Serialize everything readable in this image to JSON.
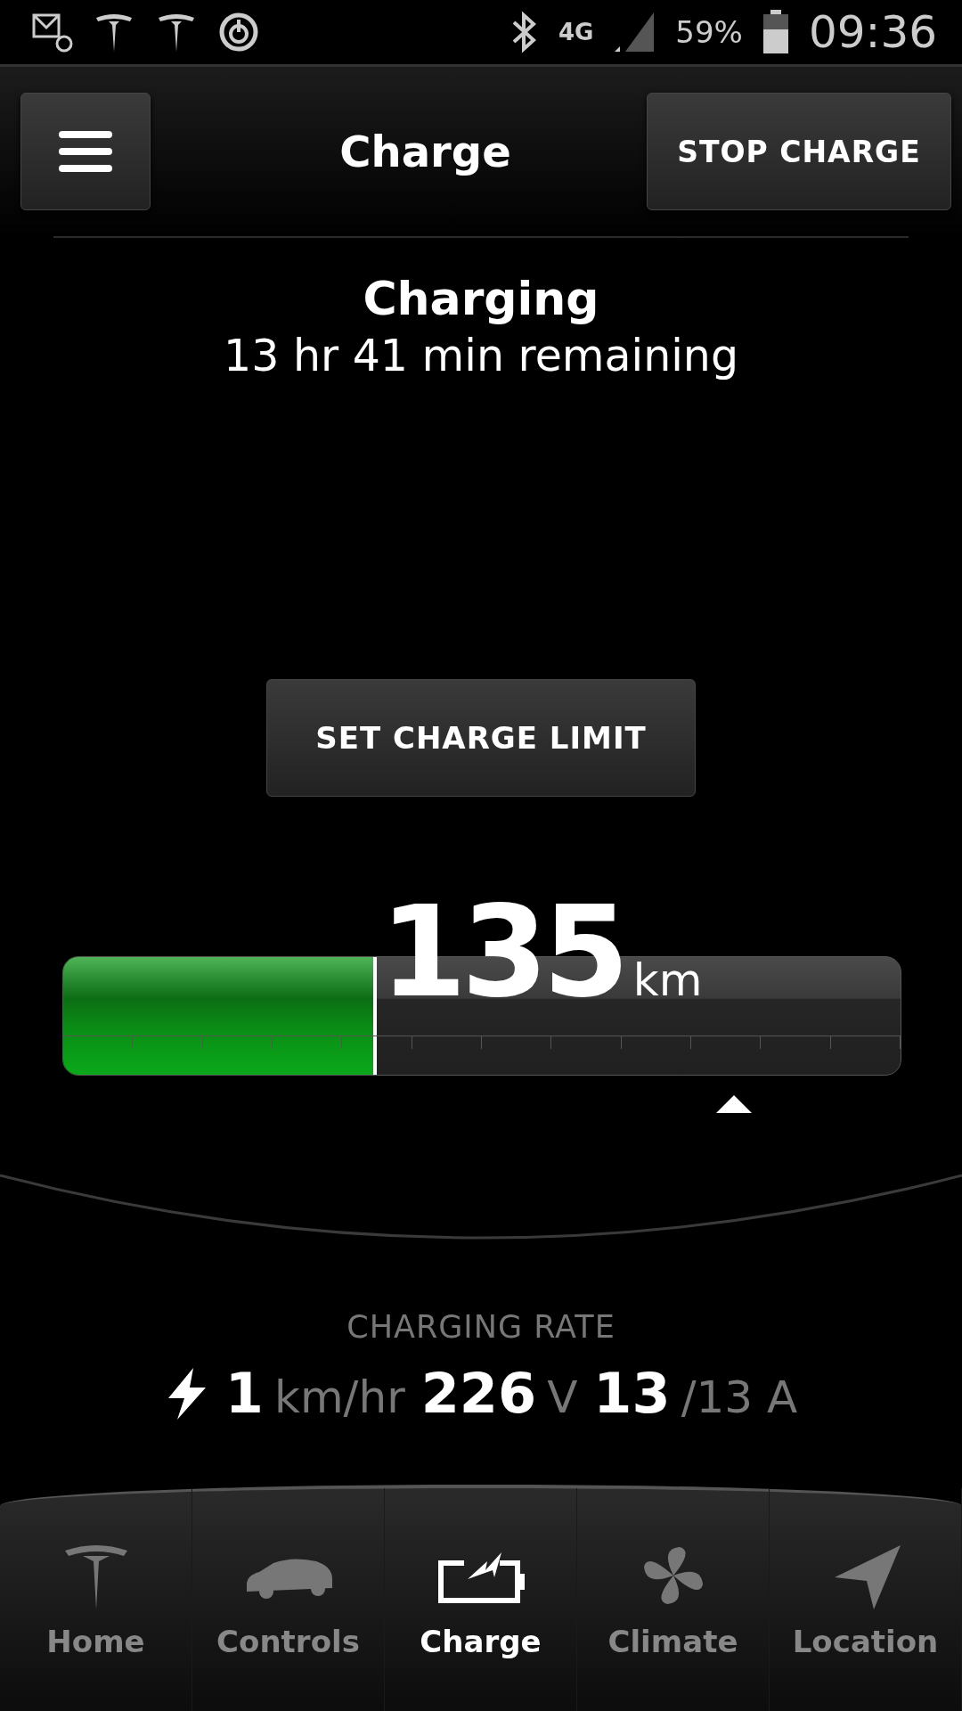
{
  "status_bar": {
    "network": "4G",
    "battery": "59%",
    "time": "09:36"
  },
  "header": {
    "title": "Charge",
    "stop_button": "STOP CHARGE"
  },
  "charge_status": {
    "title": "Charging",
    "remaining": "13 hr 41 min remaining"
  },
  "set_limit_button": "SET CHARGE LIMIT",
  "battery": {
    "level": 0.37,
    "range": "135",
    "unit": "km"
  },
  "charging_rate": {
    "label": "CHARGING RATE",
    "items": [
      {
        "value": "1",
        "unit": "km/hr"
      },
      {
        "value": "226",
        "unit": "V"
      },
      {
        "value": "13",
        "unit": "/13 A"
      }
    ]
  },
  "nav": [
    {
      "kind": "home",
      "label": "Home",
      "selected": false
    },
    {
      "kind": "controls",
      "label": "Controls",
      "selected": false
    },
    {
      "kind": "charge",
      "label": "Charge",
      "selected": true
    },
    {
      "kind": "climate",
      "label": "Climate",
      "selected": false
    },
    {
      "kind": "location",
      "label": "Location",
      "selected": false
    }
  ]
}
